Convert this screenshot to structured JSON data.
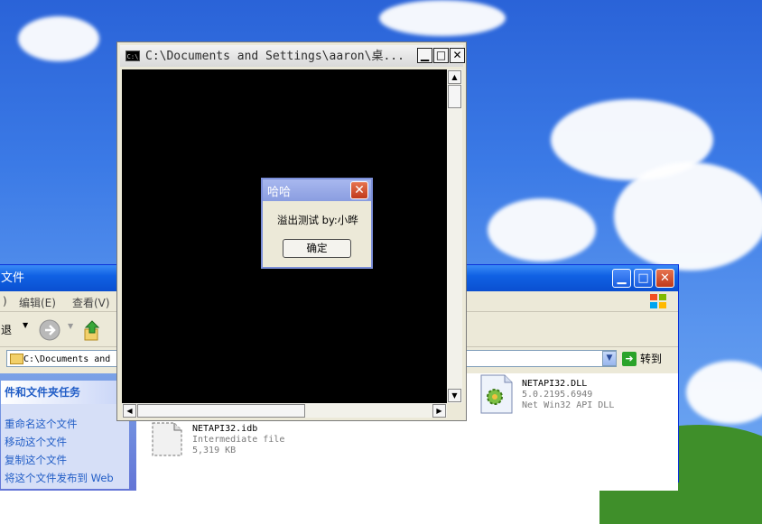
{
  "console": {
    "icon_text": "C:\\",
    "title": "C:\\Documents and Settings\\aaron\\桌...",
    "minimize": "▁",
    "maximize": "□",
    "close": "✕",
    "scroll_up": "▲",
    "scroll_down": "▼",
    "scroll_left": "◀",
    "scroll_right": "▶"
  },
  "msgbox": {
    "title": "哈哈",
    "close": "✕",
    "message": "溢出测试 by:小晔",
    "ok_label": "确定"
  },
  "explorer": {
    "title": "文件",
    "menu": [
      "编辑(E)",
      "查看(V)"
    ],
    "menu_partial": ")",
    "back_label": "退",
    "address": "C:\\Documents and",
    "address_dropdown": "▼",
    "goto_label": "转到",
    "minimize": "▁",
    "maximize": "□",
    "close": "✕",
    "task_header": "件和文件夹任务",
    "tasks": [
      "重命名这个文件",
      "移动这个文件",
      "复制这个文件",
      "将这个文件发布到 Web"
    ],
    "files": [
      {
        "name": "NETAPI32.DLL",
        "line1": "5.0.2195.6949",
        "line2": "Net Win32 API DLL",
        "icon": "dll-gear-icon"
      },
      {
        "name": "NETAPI32.idb",
        "line1": "Intermediate file",
        "line2": "5,319 KB",
        "icon": "generic-file-icon"
      }
    ]
  }
}
